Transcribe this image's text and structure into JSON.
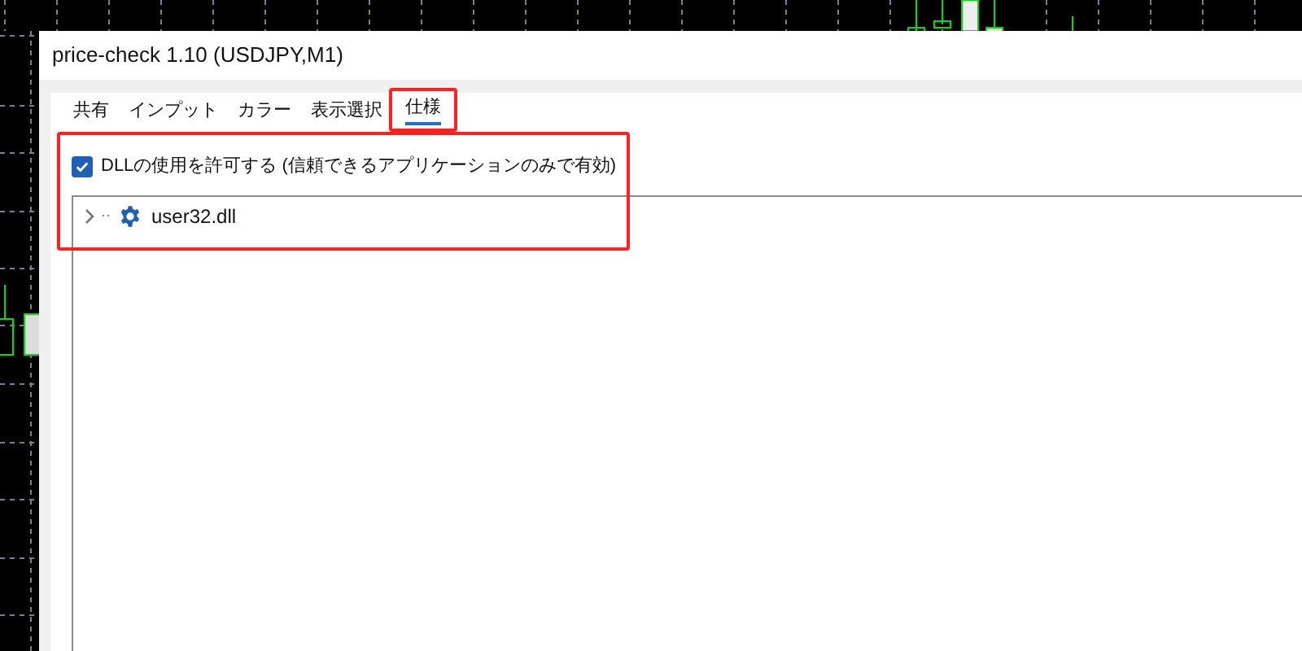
{
  "window": {
    "title": "price-check 1.10 (USDJPY,M1)"
  },
  "tabs": [
    {
      "label": "共有",
      "selected": false
    },
    {
      "label": "インプット",
      "selected": false
    },
    {
      "label": "カラー",
      "selected": false
    },
    {
      "label": "表示選択",
      "selected": false
    },
    {
      "label": "仕様",
      "selected": true,
      "highlighted": true
    }
  ],
  "dll_option": {
    "label": "DLLの使用を許可する (信頼できるアプリケーションのみで有効)",
    "checked": true
  },
  "tree": [
    {
      "label": "user32.dll",
      "expanded": false
    }
  ]
}
